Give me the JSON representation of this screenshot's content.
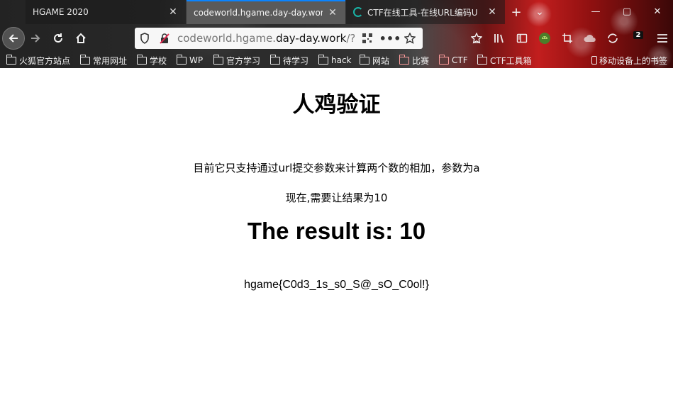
{
  "browser": {
    "tabs": [
      {
        "title": "HGAME 2020",
        "active": false
      },
      {
        "title": "codeworld.hgame.day-day.work/?a",
        "active": true
      },
      {
        "title": "CTF在线工具-在线URL编码U",
        "active": false
      }
    ],
    "close_glyph": "✕",
    "new_tab_glyph": "+",
    "tab_list_glyph": "⌄",
    "window_controls": {
      "minimize": "—",
      "maximize": "▢",
      "close": "✕"
    },
    "url": {
      "prefix": "codeworld.hgame.",
      "domain": "day-day.work",
      "path": "/?a"
    },
    "extensions_badge": "2",
    "bookmarks": [
      {
        "label": "火狐官方站点",
        "icon": "folder-icon"
      },
      {
        "label": "常用网址",
        "icon": "folder-icon"
      },
      {
        "label": "学校",
        "icon": "folder-icon"
      },
      {
        "label": "WP",
        "icon": "folder-icon"
      },
      {
        "label": "官方学习",
        "icon": "folder-icon"
      },
      {
        "label": "待学习",
        "icon": "folder-icon"
      },
      {
        "label": "hack",
        "icon": "folder-icon"
      },
      {
        "label": "网站",
        "icon": "folder-icon"
      },
      {
        "label": "比赛",
        "icon": "folder-icon"
      },
      {
        "label": "CTF",
        "icon": "folder-icon"
      },
      {
        "label": "CTF工具箱",
        "icon": "folder-icon"
      }
    ],
    "mobile_bookmarks": "移动设备上的书签"
  },
  "page": {
    "title": "人鸡验证",
    "description": "目前它只支持通过url提交参数来计算两个数的相加，参数为a",
    "requirement": "现在,需要让结果为10",
    "result": "The result is: 10",
    "flag": "hgame{C0d3_1s_s0_S@_sO_C0ol!}"
  }
}
